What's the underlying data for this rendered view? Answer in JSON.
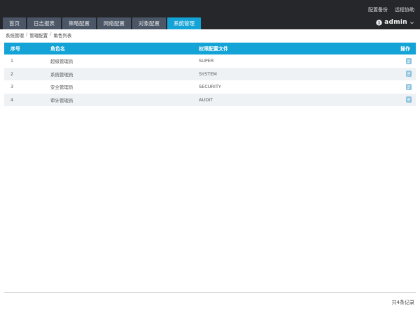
{
  "header": {
    "links": [
      "配置备份",
      "远程协助"
    ],
    "user": "admin"
  },
  "nav": {
    "tabs": [
      "首页",
      "日志报表",
      "策略配置",
      "网络配置",
      "对象配置",
      "系统管理"
    ],
    "active_index": 5
  },
  "breadcrumb": [
    "系统管理",
    "管理配置",
    "角色列表"
  ],
  "table": {
    "columns": [
      "序号",
      "角色名",
      "权限配置文件",
      "操作"
    ],
    "rows": [
      {
        "no": "1",
        "role": "超级管理员",
        "profile": "SUPER"
      },
      {
        "no": "2",
        "role": "系统管理员",
        "profile": "SYSTEM"
      },
      {
        "no": "3",
        "role": "安全管理员",
        "profile": "SECURITY"
      },
      {
        "no": "4",
        "role": "审计管理员",
        "profile": "AUDIT"
      }
    ]
  },
  "footer": {
    "total": "共4条记录"
  },
  "colors": {
    "accent": "#14a3d6",
    "topbar": "#25272b",
    "tab": "#4b5667",
    "row_alt": "#eef2f5",
    "op_icon": "#8ec5e0"
  },
  "icons": {
    "user": "info-circle-icon",
    "caret": "chevron-down-icon",
    "operation": "edit-document-icon"
  }
}
